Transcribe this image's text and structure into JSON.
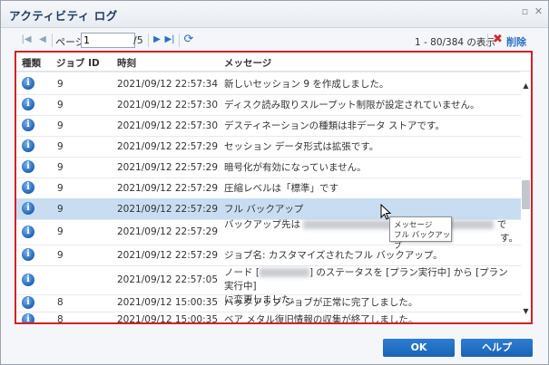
{
  "window": {
    "title": "アクティビティ ログ"
  },
  "toolbar": {
    "page_label": "ページ",
    "page_value": "1",
    "page_total": "/5",
    "range_text": "1 - 80/384 の表示",
    "delete_label": "削除"
  },
  "grid": {
    "columns": [
      "種類",
      "ジョブ ID",
      "時刻",
      "メッセージ"
    ],
    "rows": [
      {
        "job_id": "9",
        "time": "2021/09/12 22:57:34",
        "message": "新しいセッション 9 を作成しました。"
      },
      {
        "job_id": "9",
        "time": "2021/09/12 22:57:30",
        "message": "ディスク読み取りスループット制限が設定されていません。"
      },
      {
        "job_id": "9",
        "time": "2021/09/12 22:57:30",
        "message": "デスティネーションの種類は非データ ストアです。"
      },
      {
        "job_id": "9",
        "time": "2021/09/12 22:57:29",
        "message": "セッション データ形式は拡張です。"
      },
      {
        "job_id": "9",
        "time": "2021/09/12 22:57:29",
        "message": "暗号化が有効になっていません。"
      },
      {
        "job_id": "9",
        "time": "2021/09/12 22:57:29",
        "message": "圧縮レベルは「標準」です"
      },
      {
        "job_id": "9",
        "time": "2021/09/12 22:57:29",
        "message": "フル バックアップ"
      },
      {
        "job_id": "9",
        "time": "2021/09/12 22:57:29",
        "message_a": "バックアップ先は",
        "message_b": "で",
        "message_c": "す。"
      },
      {
        "job_id": "9",
        "time": "2021/09/12 22:57:29",
        "message": "ジョブ名: カスタマイズされたフル バックアップ。"
      },
      {
        "job_id": "",
        "time": "2021/09/12 22:57:05",
        "message_a": "ノード [",
        "message_b": "] のステータスを [プラン実行中] から [プラン実行中]",
        "message_c": "に変更しました。"
      },
      {
        "job_id": "8",
        "time": "2021/09/12 15:00:35",
        "message": "バックアップ ジョブが正常に完了しました。"
      },
      {
        "job_id": "8",
        "time": "2021/09/12 15:00:35",
        "message": "ベア メタル復旧情報の収集が終了しました。"
      }
    ]
  },
  "tooltip": {
    "title": "メッセージ",
    "value": "フル バックアップ"
  },
  "footer": {
    "ok_label": "OK",
    "help_label": "ヘルプ"
  },
  "colors": {
    "accent": "#1f63b8",
    "highlight_border": "#d42028",
    "selected_row": "#c9ddf2",
    "delete_icon": "#d3272f"
  }
}
